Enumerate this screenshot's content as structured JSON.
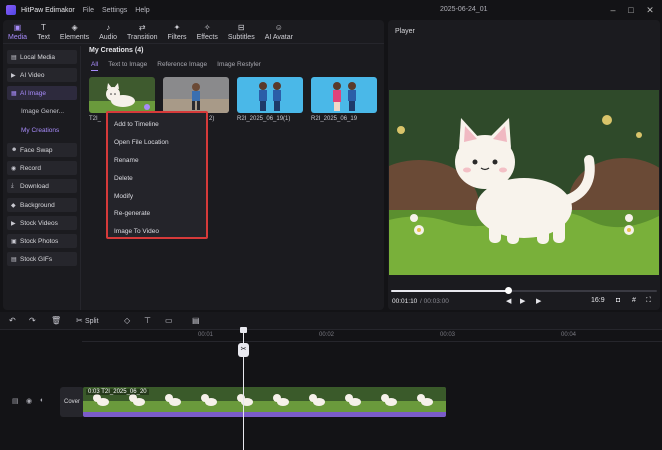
{
  "titlebar": {
    "app_name": "HitPaw Edimakor",
    "menu": [
      "File",
      "Settings",
      "Help"
    ],
    "doc_title": "2025-06-24_01"
  },
  "tabs": [
    {
      "label": "Media",
      "icon": "media-icon"
    },
    {
      "label": "Text",
      "icon": "text-icon"
    },
    {
      "label": "Elements",
      "icon": "elements-icon"
    },
    {
      "label": "Audio",
      "icon": "audio-icon"
    },
    {
      "label": "Transition",
      "icon": "transition-icon"
    },
    {
      "label": "Filters",
      "icon": "filters-icon"
    },
    {
      "label": "Effects",
      "icon": "effects-icon"
    },
    {
      "label": "Subtitles",
      "icon": "subtitles-icon"
    },
    {
      "label": "AI Avatar",
      "icon": "ai-avatar-icon"
    }
  ],
  "sidebar": {
    "items": [
      {
        "label": "Local Media"
      },
      {
        "label": "AI Video"
      },
      {
        "label": "AI Image"
      },
      {
        "label": "Face Swap"
      },
      {
        "label": "Record"
      },
      {
        "label": "Download"
      },
      {
        "label": "Background"
      },
      {
        "label": "Stock Videos"
      },
      {
        "label": "Stock Photos"
      },
      {
        "label": "Stock GIFs"
      }
    ],
    "sub_items": [
      "Image Gener...",
      "My Creations"
    ]
  },
  "content": {
    "title": "My Creations (4)",
    "filter_tabs": [
      "All",
      "Text to Image",
      "Reference Image",
      "Image Restyler"
    ],
    "thumbs": [
      {
        "label": "T2I_"
      },
      {
        "label": "2)"
      },
      {
        "label": "R2I_2025_06_19(1)"
      },
      {
        "label": "R2I_2025_06_19"
      }
    ]
  },
  "context_menu": {
    "items": [
      "Add to Timeline",
      "Open File Location",
      "Rename",
      "Delete",
      "Modify",
      "Re-generate",
      "Image To Video"
    ]
  },
  "player": {
    "title": "Player",
    "time_current": "00:01:10",
    "time_total": "/ 00:03:00",
    "aspect": "16:9",
    "progress": 0.44
  },
  "toolbar": {
    "split_label": "Split"
  },
  "timeline": {
    "ruler_labels": [
      "00:01",
      "00:02",
      "00:03",
      "00:04"
    ],
    "cover_label": "Cover",
    "clip_label": "0:03  T2I_2025_06_20"
  },
  "colors": {
    "accent": "#a78bfa",
    "highlight_border": "#d63a3a",
    "clip_bar": "#7b5cc9"
  }
}
